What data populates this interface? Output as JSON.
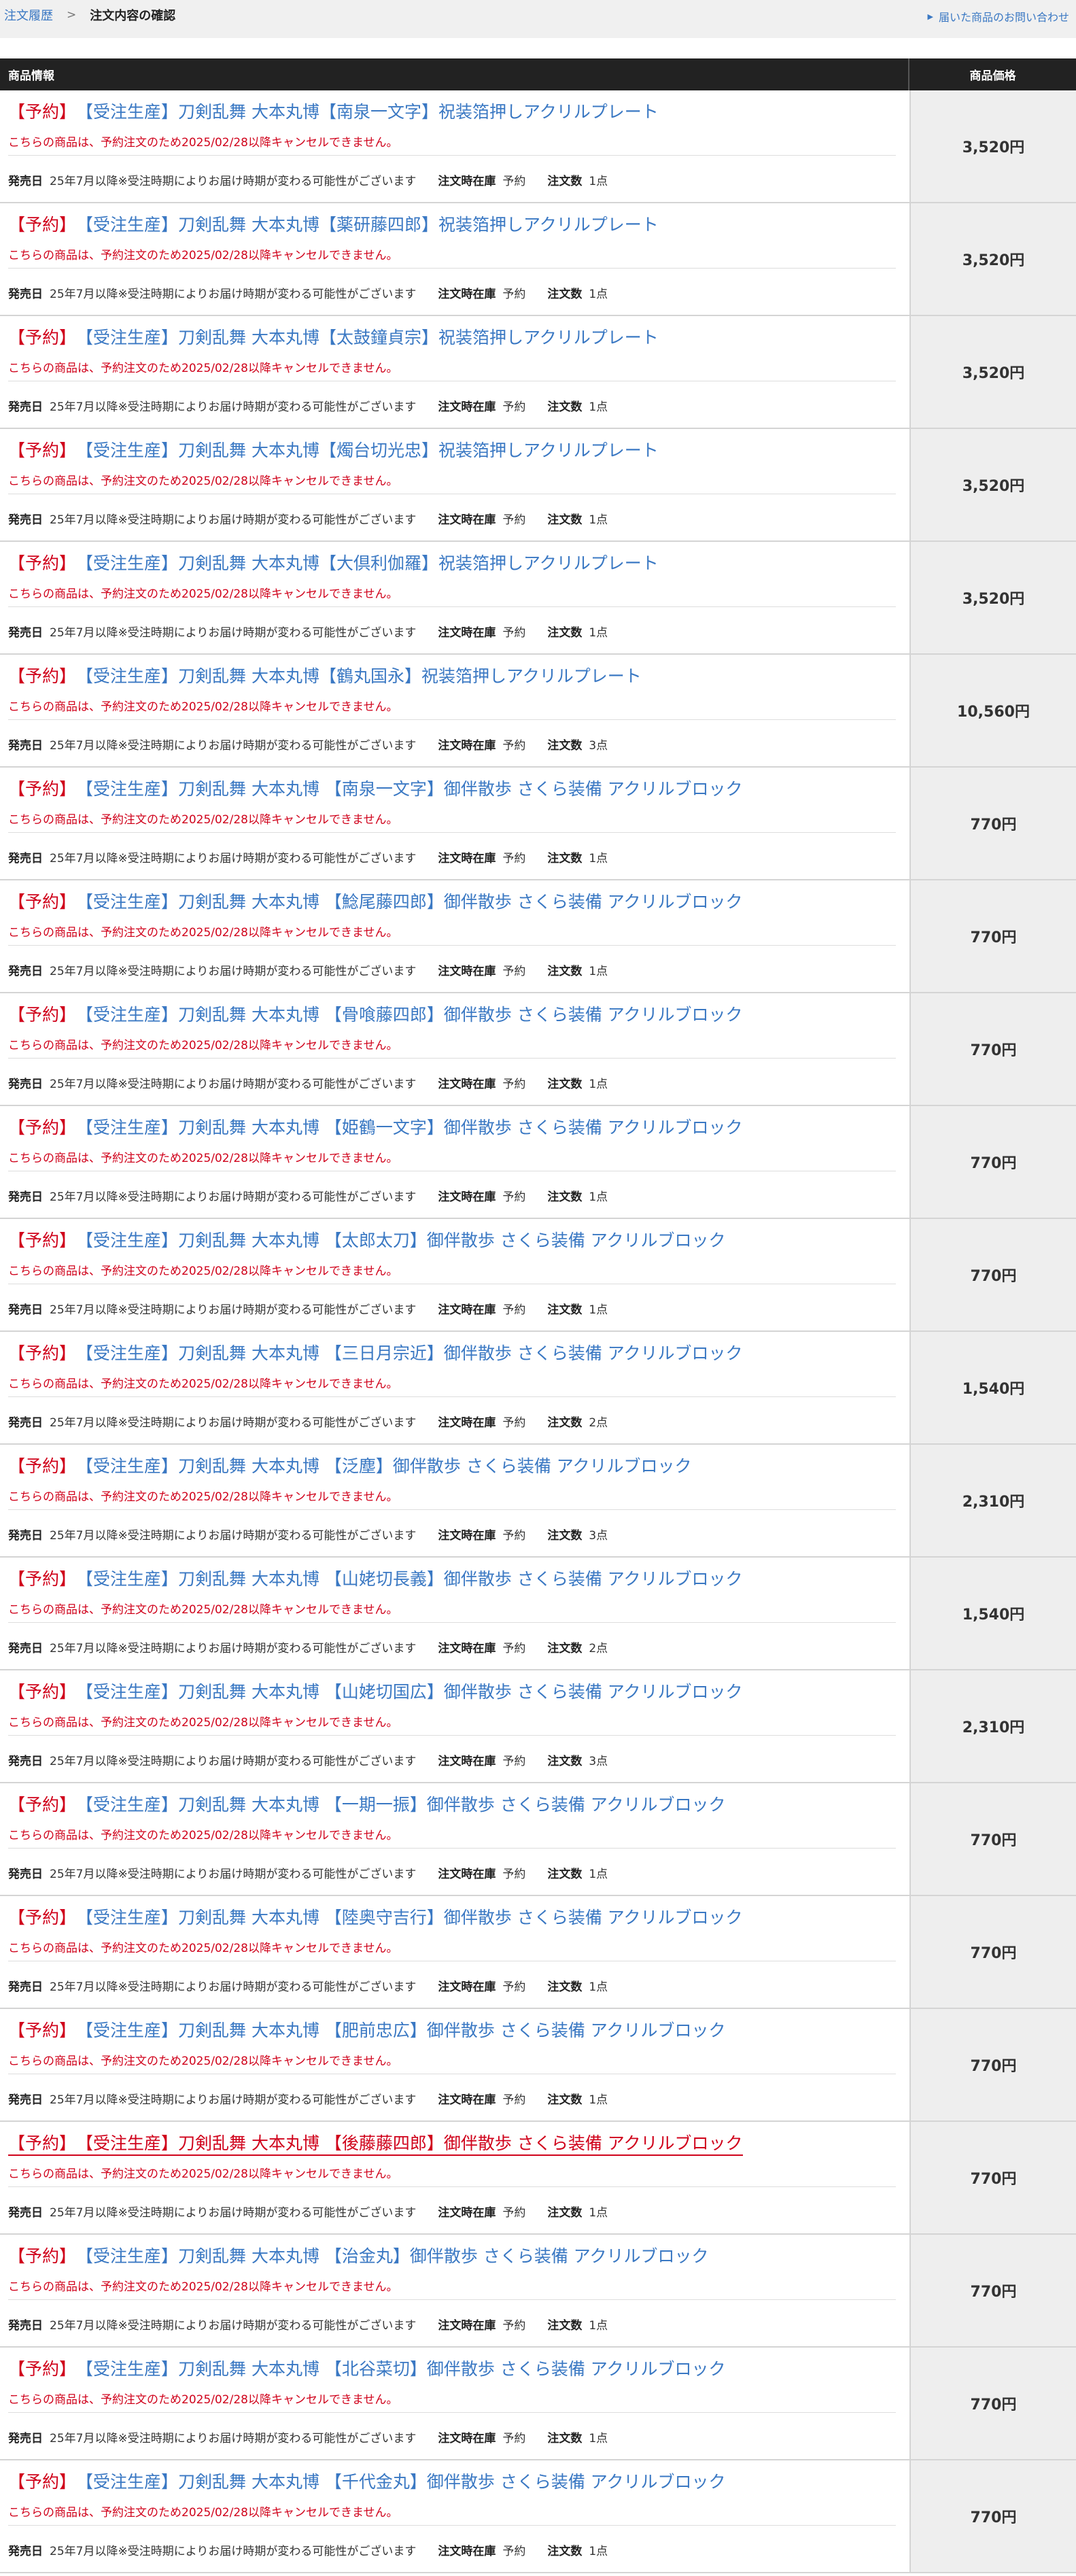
{
  "header": {
    "breadcrumb_link": "注文履歴",
    "breadcrumb_sep": ">",
    "breadcrumb_current": "注文内容の確認",
    "inquiry_label": "届いた商品のお問い合わせ"
  },
  "table": {
    "col_info": "商品情報",
    "col_price": "商品価格"
  },
  "labels": {
    "release": "発売日",
    "stock": "注文時在庫",
    "qty": "注文数",
    "notice": "こちらの商品は、予約注文のため2025/02/28以降キャンセルできません。"
  },
  "items": [
    {
      "resv": "【予約】",
      "name": "【受注生産】刀剣乱舞 大本丸博【南泉一文字】祝装箔押しアクリルプレート",
      "release": "25年7月以降※受注時期によりお届け時期が変わる可能性がございます",
      "stock": "予約",
      "qty": "1点",
      "price": "3,520円"
    },
    {
      "resv": "【予約】",
      "name": "【受注生産】刀剣乱舞 大本丸博【薬研藤四郎】祝装箔押しアクリルプレート",
      "release": "25年7月以降※受注時期によりお届け時期が変わる可能性がございます",
      "stock": "予約",
      "qty": "1点",
      "price": "3,520円"
    },
    {
      "resv": "【予約】",
      "name": "【受注生産】刀剣乱舞 大本丸博【太鼓鐘貞宗】祝装箔押しアクリルプレート",
      "release": "25年7月以降※受注時期によりお届け時期が変わる可能性がございます",
      "stock": "予約",
      "qty": "1点",
      "price": "3,520円"
    },
    {
      "resv": "【予約】",
      "name": "【受注生産】刀剣乱舞 大本丸博【燭台切光忠】祝装箔押しアクリルプレート",
      "release": "25年7月以降※受注時期によりお届け時期が変わる可能性がございます",
      "stock": "予約",
      "qty": "1点",
      "price": "3,520円"
    },
    {
      "resv": "【予約】",
      "name": "【受注生産】刀剣乱舞 大本丸博【大倶利伽羅】祝装箔押しアクリルプレート",
      "release": "25年7月以降※受注時期によりお届け時期が変わる可能性がございます",
      "stock": "予約",
      "qty": "1点",
      "price": "3,520円"
    },
    {
      "resv": "【予約】",
      "name": "【受注生産】刀剣乱舞 大本丸博【鶴丸国永】祝装箔押しアクリルプレート",
      "release": "25年7月以降※受注時期によりお届け時期が変わる可能性がございます",
      "stock": "予約",
      "qty": "3点",
      "price": "10,560円"
    },
    {
      "resv": "【予約】",
      "name": "【受注生産】刀剣乱舞 大本丸博 【南泉一文字】御伴散歩 さくら装備 アクリルブロック",
      "release": "25年7月以降※受注時期によりお届け時期が変わる可能性がございます",
      "stock": "予約",
      "qty": "1点",
      "price": "770円"
    },
    {
      "resv": "【予約】",
      "name": "【受注生産】刀剣乱舞 大本丸博 【鯰尾藤四郎】御伴散歩 さくら装備 アクリルブロック",
      "release": "25年7月以降※受注時期によりお届け時期が変わる可能性がございます",
      "stock": "予約",
      "qty": "1点",
      "price": "770円"
    },
    {
      "resv": "【予約】",
      "name": "【受注生産】刀剣乱舞 大本丸博 【骨喰藤四郎】御伴散歩 さくら装備 アクリルブロック",
      "release": "25年7月以降※受注時期によりお届け時期が変わる可能性がございます",
      "stock": "予約",
      "qty": "1点",
      "price": "770円"
    },
    {
      "resv": "【予約】",
      "name": "【受注生産】刀剣乱舞 大本丸博 【姫鶴一文字】御伴散歩 さくら装備 アクリルブロック",
      "release": "25年7月以降※受注時期によりお届け時期が変わる可能性がございます",
      "stock": "予約",
      "qty": "1点",
      "price": "770円"
    },
    {
      "resv": "【予約】",
      "name": "【受注生産】刀剣乱舞 大本丸博 【太郎太刀】御伴散歩 さくら装備 アクリルブロック",
      "release": "25年7月以降※受注時期によりお届け時期が変わる可能性がございます",
      "stock": "予約",
      "qty": "1点",
      "price": "770円"
    },
    {
      "resv": "【予約】",
      "name": "【受注生産】刀剣乱舞 大本丸博 【三日月宗近】御伴散歩 さくら装備 アクリルブロック",
      "release": "25年7月以降※受注時期によりお届け時期が変わる可能性がございます",
      "stock": "予約",
      "qty": "2点",
      "price": "1,540円"
    },
    {
      "resv": "【予約】",
      "name": "【受注生産】刀剣乱舞 大本丸博 【泛塵】御伴散歩 さくら装備 アクリルブロック",
      "release": "25年7月以降※受注時期によりお届け時期が変わる可能性がございます",
      "stock": "予約",
      "qty": "3点",
      "price": "2,310円"
    },
    {
      "resv": "【予約】",
      "name": "【受注生産】刀剣乱舞 大本丸博 【山姥切長義】御伴散歩 さくら装備 アクリルブロック",
      "release": "25年7月以降※受注時期によりお届け時期が変わる可能性がございます",
      "stock": "予約",
      "qty": "2点",
      "price": "1,540円"
    },
    {
      "resv": "【予約】",
      "name": "【受注生産】刀剣乱舞 大本丸博 【山姥切国広】御伴散歩 さくら装備 アクリルブロック",
      "release": "25年7月以降※受注時期によりお届け時期が変わる可能性がございます",
      "stock": "予約",
      "qty": "3点",
      "price": "2,310円"
    },
    {
      "resv": "【予約】",
      "name": "【受注生産】刀剣乱舞 大本丸博 【一期一振】御伴散歩 さくら装備 アクリルブロック",
      "release": "25年7月以降※受注時期によりお届け時期が変わる可能性がございます",
      "stock": "予約",
      "qty": "1点",
      "price": "770円"
    },
    {
      "resv": "【予約】",
      "name": "【受注生産】刀剣乱舞 大本丸博 【陸奥守吉行】御伴散歩 さくら装備 アクリルブロック",
      "release": "25年7月以降※受注時期によりお届け時期が変わる可能性がございます",
      "stock": "予約",
      "qty": "1点",
      "price": "770円"
    },
    {
      "resv": "【予約】",
      "name": "【受注生産】刀剣乱舞 大本丸博 【肥前忠広】御伴散歩 さくら装備 アクリルブロック",
      "release": "25年7月以降※受注時期によりお届け時期が変わる可能性がございます",
      "stock": "予約",
      "qty": "1点",
      "price": "770円"
    },
    {
      "resv": "【予約】",
      "name": "【受注生産】刀剣乱舞 大本丸博 【後藤藤四郎】御伴散歩 さくら装備 アクリルブロック",
      "release": "25年7月以降※受注時期によりお届け時期が変わる可能性がございます",
      "stock": "予約",
      "qty": "1点",
      "price": "770円",
      "hover": true
    },
    {
      "resv": "【予約】",
      "name": "【受注生産】刀剣乱舞 大本丸博 【治金丸】御伴散歩 さくら装備 アクリルブロック",
      "release": "25年7月以降※受注時期によりお届け時期が変わる可能性がございます",
      "stock": "予約",
      "qty": "1点",
      "price": "770円"
    },
    {
      "resv": "【予約】",
      "name": "【受注生産】刀剣乱舞 大本丸博 【北谷菜切】御伴散歩 さくら装備 アクリルブロック",
      "release": "25年7月以降※受注時期によりお届け時期が変わる可能性がございます",
      "stock": "予約",
      "qty": "1点",
      "price": "770円"
    },
    {
      "resv": "【予約】",
      "name": "【受注生産】刀剣乱舞 大本丸博 【千代金丸】御伴散歩 さくら装備 アクリルブロック",
      "release": "25年7月以降※受注時期によりお届け時期が変わる可能性がございます",
      "stock": "予約",
      "qty": "1点",
      "price": "770円"
    }
  ]
}
